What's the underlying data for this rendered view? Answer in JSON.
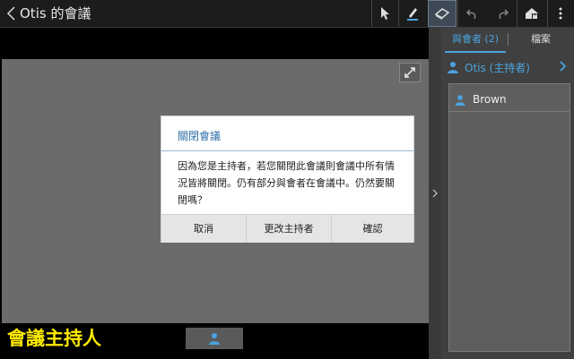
{
  "window": {
    "title": "Otis 的會議"
  },
  "toolbar": {
    "tools": [
      {
        "name": "pointer",
        "icon": "pointer-icon"
      },
      {
        "name": "pen",
        "icon": "pen-icon"
      },
      {
        "name": "eraser",
        "icon": "eraser-icon",
        "selected": true
      },
      {
        "name": "undo",
        "icon": "undo-icon"
      },
      {
        "name": "redo",
        "icon": "redo-icon"
      },
      {
        "name": "lock",
        "icon": "lock-icon"
      },
      {
        "name": "more",
        "icon": "more-vertical-icon"
      }
    ]
  },
  "panel": {
    "tabs": [
      {
        "label": "與會者 (2)",
        "active": true
      },
      {
        "label": "檔案",
        "active": false
      }
    ],
    "host": {
      "name": "Otis (主持者)"
    },
    "members": [
      {
        "name": "Brown"
      }
    ]
  },
  "dialog": {
    "title": "關閉會議",
    "message": "因為您是主持者，若您關閉此會議則會議中所有情況皆將關閉。仍有部分與會者在會議中。仍然要關閉嗎？",
    "buttons": {
      "cancel": "取消",
      "change_host": "更改主持者",
      "confirm": "確認"
    }
  },
  "caption": "會議主持人",
  "colors": {
    "accent": "#4aa3df",
    "caption": "#ffeb00",
    "dialog_title": "#2f6fa7"
  }
}
